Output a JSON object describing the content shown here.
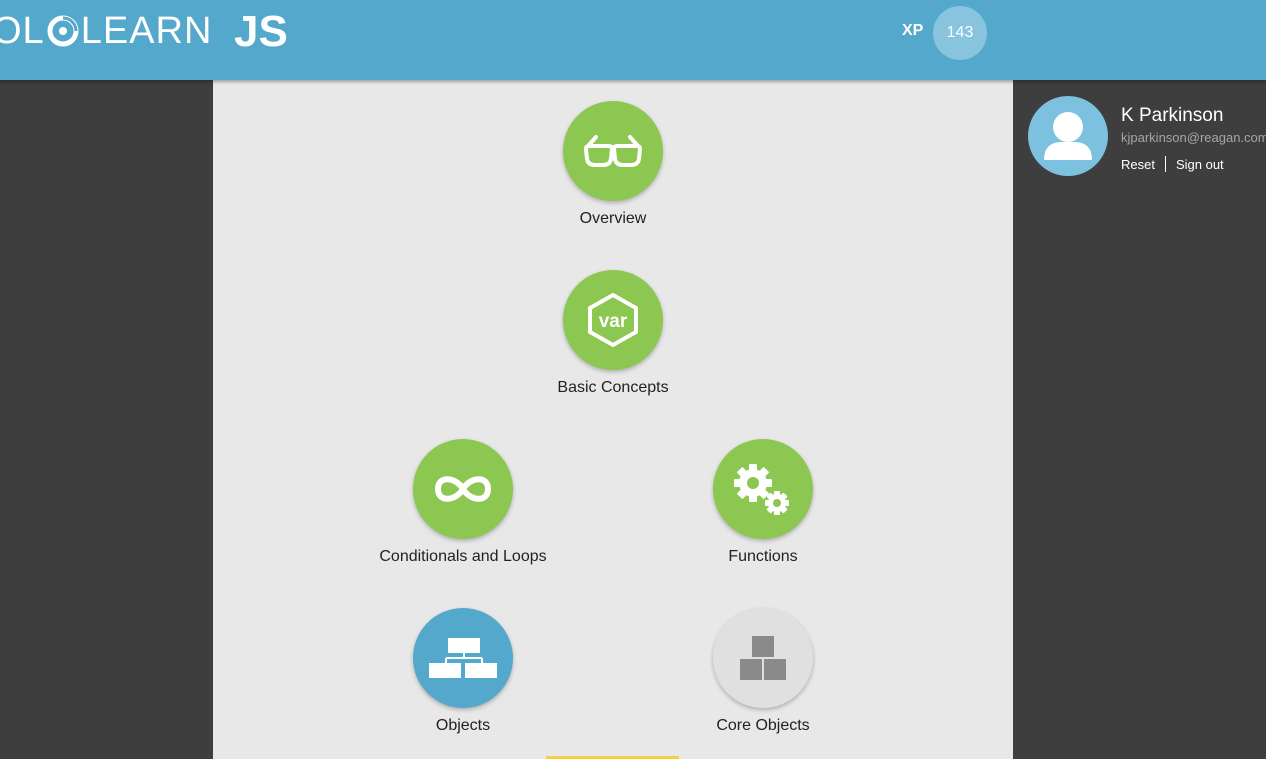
{
  "header": {
    "logo_left": "OL",
    "logo_right": "LEARN",
    "course_title": "JS",
    "xp_label": "XP",
    "xp_value": "143"
  },
  "lessons": [
    {
      "label": "Overview",
      "icon": "glasses-icon",
      "state": "completed"
    },
    {
      "label": "Basic Concepts",
      "icon": "var-hexagon-icon",
      "state": "completed"
    },
    {
      "label": "Conditionals and Loops",
      "icon": "infinity-icon",
      "state": "completed"
    },
    {
      "label": "Functions",
      "icon": "gears-icon",
      "state": "completed"
    },
    {
      "label": "Objects",
      "icon": "hierarchy-icon",
      "state": "current"
    },
    {
      "label": "Core Objects",
      "icon": "blocks-icon",
      "state": "locked"
    }
  ],
  "user": {
    "name": "K Parkinson",
    "email": "kjparkinson@reagan.com",
    "reset_label": "Reset",
    "signout_label": "Sign out"
  },
  "colors": {
    "header": "#54a8cb",
    "completed": "#8cc751",
    "current": "#54a8cb",
    "locked": "#e0e0e0",
    "sidebar": "#3e3e3e",
    "panel": "#e8e8e8"
  }
}
